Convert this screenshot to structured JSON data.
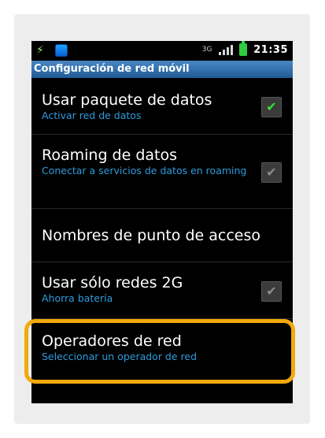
{
  "statusbar": {
    "network_type": "3G",
    "time": "21:35",
    "icons": [
      "usb-icon",
      "sync-icon",
      "network-type-icon",
      "signal-icon",
      "battery-icon"
    ]
  },
  "titlebar": {
    "title": "Configuración de red móvil"
  },
  "settings": [
    {
      "title": "Usar paquete de datos",
      "subtitle": "Activar red de datos",
      "checkbox": "checked-green"
    },
    {
      "title": "Roaming de datos",
      "subtitle": "Conectar a servicios de datos en roaming",
      "checkbox": "checked-gray"
    },
    {
      "title": "Nombres de punto de acceso",
      "subtitle": "",
      "checkbox": "none"
    },
    {
      "title": "Usar sólo redes 2G",
      "subtitle": "Ahorra batería",
      "checkbox": "checked-gray"
    },
    {
      "title": "Operadores de red",
      "subtitle": "Seleccionar un operador de red",
      "checkbox": "none"
    }
  ],
  "colors": {
    "accent_blue": "#2f9bdd",
    "highlight": "#f2a90b",
    "check_green": "#35e035"
  }
}
